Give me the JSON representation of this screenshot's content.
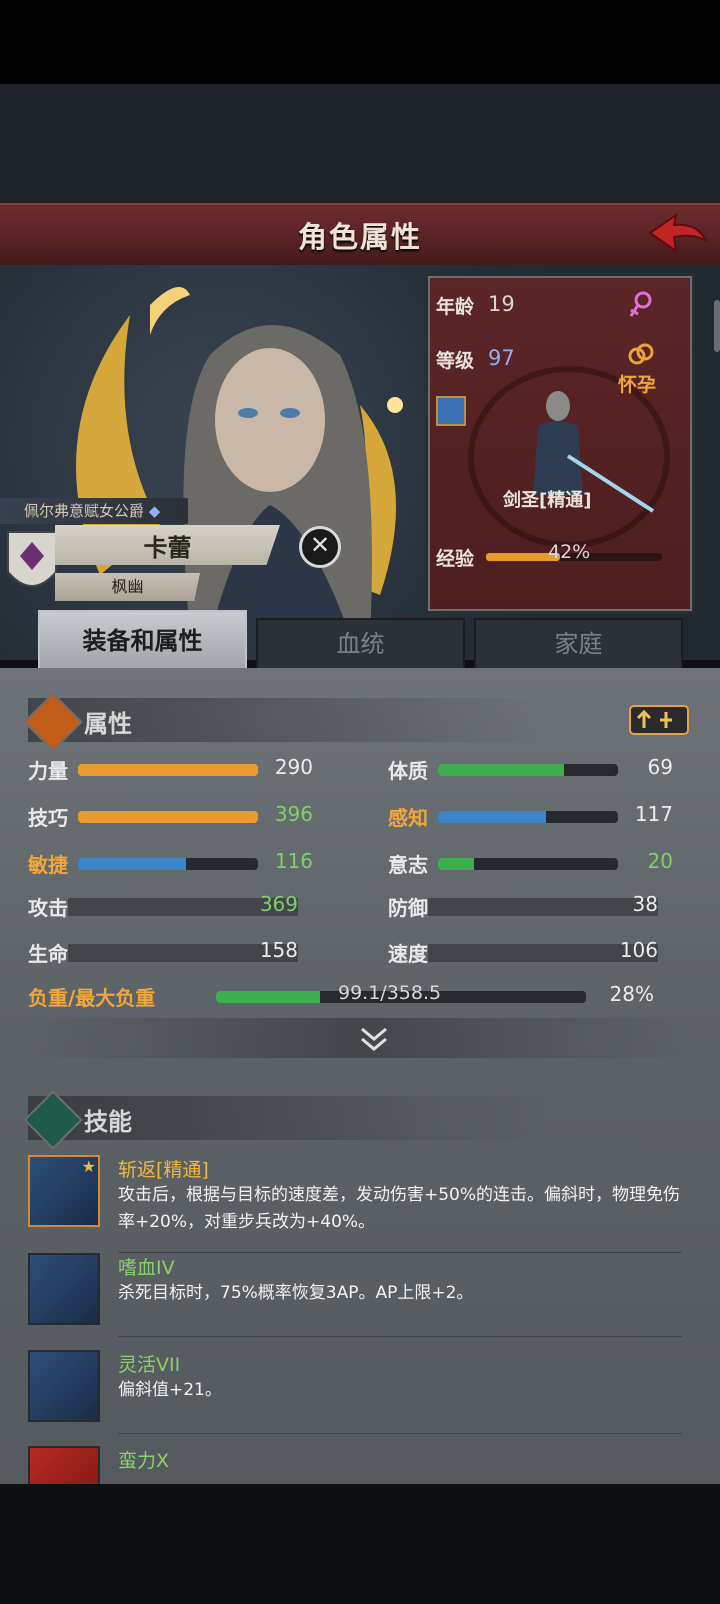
{
  "header": {
    "title": "角色属性"
  },
  "character": {
    "title": "佩尔弗意赋女公爵",
    "name": "卡蕾",
    "clan": "枫幽",
    "age_label": "年龄",
    "age": "19",
    "level_label": "等级",
    "level": "97",
    "status": "怀孕",
    "class_name": "剑圣[精通]",
    "exp_label": "经验",
    "exp_percent": "42%",
    "exp_fraction": 0.42
  },
  "tabs": [
    "装备和属性",
    "血统",
    "家庭"
  ],
  "attributes": {
    "header": "属性",
    "left": [
      {
        "label": "力量",
        "value": "290",
        "fill": 1.0,
        "color": "#e89a2c"
      },
      {
        "label": "技巧",
        "value": "396",
        "fill": 1.0,
        "color": "#e89a2c"
      },
      {
        "label": "敏捷",
        "value": "116",
        "fill": 0.6,
        "color": "#3a86c8"
      }
    ],
    "right": [
      {
        "label": "体质",
        "value": "69",
        "fill": 0.7,
        "color": "#3fae4f"
      },
      {
        "label": "感知",
        "value": "117",
        "fill": 0.6,
        "color": "#3a86c8"
      },
      {
        "label": "意志",
        "value": "20",
        "fill": 0.2,
        "color": "#3fae4f"
      }
    ],
    "combat_left": [
      {
        "label": "攻击",
        "value": "369"
      },
      {
        "label": "生命",
        "value": "158"
      }
    ],
    "combat_right": [
      {
        "label": "防御",
        "value": "38"
      },
      {
        "label": "速度",
        "value": "106"
      }
    ],
    "load_label": "负重/最大负重",
    "load_value": "99.1/358.5",
    "load_percent": "28%",
    "load_fraction": 0.28
  },
  "skills": {
    "header": "技能",
    "items": [
      {
        "name": "斩返[精通]",
        "desc": "攻击后，根据与目标的速度差，发动伤害+50%的连击。偏斜时，物理免伤率+20%，对重步兵改为+40%。"
      },
      {
        "name": "嗜血IV",
        "desc": "杀死目标时，75%概率恢复3AP。AP上限+2。"
      },
      {
        "name": "灵活VII",
        "desc": "偏斜值+21。"
      },
      {
        "name": "蛮力X",
        "desc": ""
      }
    ]
  },
  "colors": {
    "accent_orange": "#f0a63a",
    "header_red": "#5a2326",
    "green_text": "#8ad06c"
  }
}
